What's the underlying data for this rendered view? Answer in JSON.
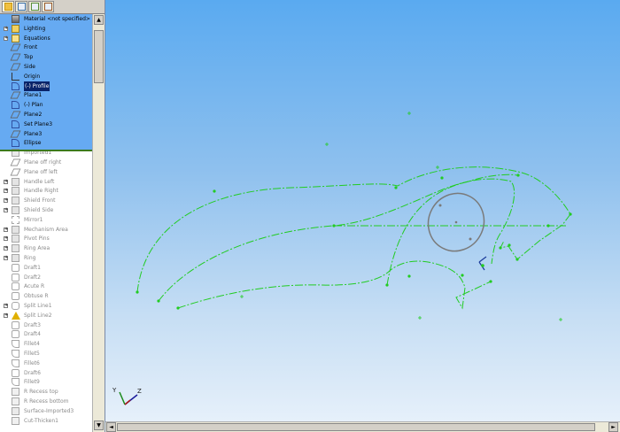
{
  "tree_tabs": [
    {
      "icon": "feature-manager-icon"
    },
    {
      "icon": "property-manager-icon"
    },
    {
      "icon": "configuration-manager-icon"
    },
    {
      "icon": "display-manager-icon"
    }
  ],
  "tree_items": [
    {
      "label": "Material <not specified>",
      "icon": "material-icon",
      "state": "active",
      "expandable": false
    },
    {
      "label": "Lighting",
      "icon": "lighting-folder-icon",
      "state": "active",
      "expandable": true
    },
    {
      "label": "Equations",
      "icon": "equations-icon",
      "state": "active",
      "expandable": true
    },
    {
      "label": "Front",
      "icon": "plane-icon",
      "state": "active",
      "expandable": false
    },
    {
      "label": "Top",
      "icon": "plane-icon",
      "state": "active",
      "expandable": false
    },
    {
      "label": "Side",
      "icon": "plane-icon",
      "state": "active",
      "expandable": false
    },
    {
      "label": "Origin",
      "icon": "origin-icon",
      "state": "active",
      "expandable": false
    },
    {
      "label": "(-) Profile",
      "icon": "sketch-icon",
      "state": "selected",
      "expandable": false
    },
    {
      "label": "Plane1",
      "icon": "plane-icon",
      "state": "active",
      "expandable": false
    },
    {
      "label": "(-) Plan",
      "icon": "sketch-icon",
      "state": "active",
      "expandable": false
    },
    {
      "label": "Plane2",
      "icon": "plane-icon",
      "state": "active",
      "expandable": false
    },
    {
      "label": "Set Plane3",
      "icon": "sketch-icon",
      "state": "active",
      "expandable": false
    },
    {
      "label": "Plane3",
      "icon": "plane-icon",
      "state": "active",
      "expandable": false
    },
    {
      "label": "Ellipse",
      "icon": "sketch-icon",
      "state": "active",
      "expandable": false
    },
    {
      "label": "Imported1",
      "icon": "surface-icon",
      "state": "suppressed",
      "expandable": false
    },
    {
      "label": "Plane off right",
      "icon": "plane-icon",
      "state": "suppressed",
      "expandable": false
    },
    {
      "label": "Plane off left",
      "icon": "plane-icon",
      "state": "suppressed",
      "expandable": false
    },
    {
      "label": "Handle Left",
      "icon": "feature-icon",
      "state": "suppressed",
      "expandable": true
    },
    {
      "label": "Handle Right",
      "icon": "feature-icon",
      "state": "suppressed",
      "expandable": true
    },
    {
      "label": "Shield Front",
      "icon": "feature-icon",
      "state": "suppressed",
      "expandable": true
    },
    {
      "label": "Shield Side",
      "icon": "feature-icon",
      "state": "suppressed",
      "expandable": true
    },
    {
      "label": "Mirror1",
      "icon": "mirror-icon",
      "state": "suppressed",
      "expandable": false
    },
    {
      "label": "Mechanism Area",
      "icon": "feature-icon",
      "state": "suppressed",
      "expandable": true
    },
    {
      "label": "Pivot Pins",
      "icon": "feature-icon",
      "state": "suppressed",
      "expandable": true
    },
    {
      "label": "Ring Area",
      "icon": "feature-icon",
      "state": "suppressed",
      "expandable": true
    },
    {
      "label": "Ring",
      "icon": "feature-icon",
      "state": "suppressed",
      "expandable": true
    },
    {
      "label": "Draft1",
      "icon": "draft-icon",
      "state": "suppressed",
      "expandable": false
    },
    {
      "label": "Draft2",
      "icon": "draft-icon",
      "state": "suppressed",
      "expandable": false
    },
    {
      "label": "Acute R",
      "icon": "draft-icon",
      "state": "suppressed",
      "expandable": false
    },
    {
      "label": "Obtuse R",
      "icon": "draft-icon",
      "state": "suppressed",
      "expandable": false
    },
    {
      "label": "Split Line1",
      "icon": "split-line-icon",
      "state": "suppressed",
      "expandable": true
    },
    {
      "label": "Split Line2",
      "icon": "warning-icon",
      "state": "suppressed",
      "expandable": true
    },
    {
      "label": "Draft3",
      "icon": "draft-icon",
      "state": "suppressed",
      "expandable": false
    },
    {
      "label": "Draft4",
      "icon": "draft-icon",
      "state": "suppressed",
      "expandable": false
    },
    {
      "label": "Fillet4",
      "icon": "fillet-icon",
      "state": "suppressed",
      "expandable": false
    },
    {
      "label": "Fillet5",
      "icon": "fillet-icon",
      "state": "suppressed",
      "expandable": false
    },
    {
      "label": "Fillet6",
      "icon": "fillet-icon",
      "state": "suppressed",
      "expandable": false
    },
    {
      "label": "Draft6",
      "icon": "draft-icon",
      "state": "suppressed",
      "expandable": false
    },
    {
      "label": "Fillet9",
      "icon": "fillet-icon",
      "state": "suppressed",
      "expandable": false
    },
    {
      "label": "R Recess top",
      "icon": "cut-icon",
      "state": "suppressed",
      "expandable": false
    },
    {
      "label": "R Recess bottom",
      "icon": "cut-icon",
      "state": "suppressed",
      "expandable": false
    },
    {
      "label": "Surface-Imported3",
      "icon": "surface-icon",
      "state": "suppressed",
      "expandable": false
    },
    {
      "label": "Cut-Thicken1",
      "icon": "cut-icon",
      "state": "suppressed",
      "expandable": false
    }
  ],
  "triad": {
    "y_label": "Y",
    "z_label": "Z"
  },
  "colors": {
    "sketch_line": "#22cc22",
    "ellipse": "#7a7a7a",
    "tree_active_bg": "#66aaf2",
    "rollback_bar": "#3c7a1e",
    "selection_bg": "#0a246a"
  }
}
